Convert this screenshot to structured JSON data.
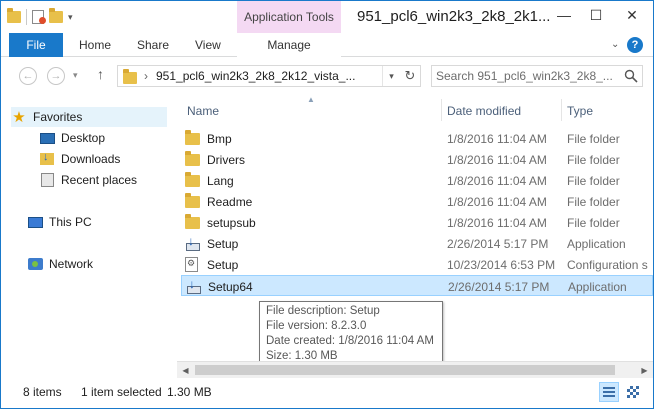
{
  "window": {
    "title": "951_pcl6_win2k3_2k8_2k1...",
    "contextual_group": "Application Tools",
    "controls": {
      "minimize": "—",
      "maximize": "☐",
      "close": "✕"
    }
  },
  "ribbon": {
    "tabs": {
      "file": "File",
      "home": "Home",
      "share": "Share",
      "view": "View",
      "manage": "Manage"
    },
    "help": "?"
  },
  "address": {
    "path": "951_pcl6_win2k3_2k8_2k12_vista_...",
    "search_placeholder": "Search 951_pcl6_win2k3_2k8_..."
  },
  "nav": {
    "favorites": "Favorites",
    "desktop": "Desktop",
    "downloads": "Downloads",
    "recent": "Recent places",
    "this_pc": "This PC",
    "network": "Network"
  },
  "columns": {
    "name": "Name",
    "date": "Date modified",
    "type": "Type"
  },
  "files": [
    {
      "name": "Bmp",
      "date": "1/8/2016 11:04 AM",
      "type": "File folder",
      "icon": "folder"
    },
    {
      "name": "Drivers",
      "date": "1/8/2016 11:04 AM",
      "type": "File folder",
      "icon": "folder"
    },
    {
      "name": "Lang",
      "date": "1/8/2016 11:04 AM",
      "type": "File folder",
      "icon": "folder"
    },
    {
      "name": "Readme",
      "date": "1/8/2016 11:04 AM",
      "type": "File folder",
      "icon": "folder"
    },
    {
      "name": "setupsub",
      "date": "1/8/2016 11:04 AM",
      "type": "File folder",
      "icon": "folder"
    },
    {
      "name": "Setup",
      "date": "2/26/2014 5:17 PM",
      "type": "Application",
      "icon": "setup"
    },
    {
      "name": "Setup",
      "date": "10/23/2014 6:53 PM",
      "type": "Configuration s",
      "icon": "config"
    },
    {
      "name": "Setup64",
      "date": "2/26/2014 5:17 PM",
      "type": "Application",
      "icon": "setup",
      "selected": true
    }
  ],
  "tooltip": {
    "description": "File description: Setup",
    "version": "File version: 8.2.3.0",
    "created": "Date created: 1/8/2016 11:04 AM",
    "size": "Size: 1.30 MB"
  },
  "status": {
    "items": "8 items",
    "selected": "1 item selected",
    "size": "1.30 MB"
  }
}
